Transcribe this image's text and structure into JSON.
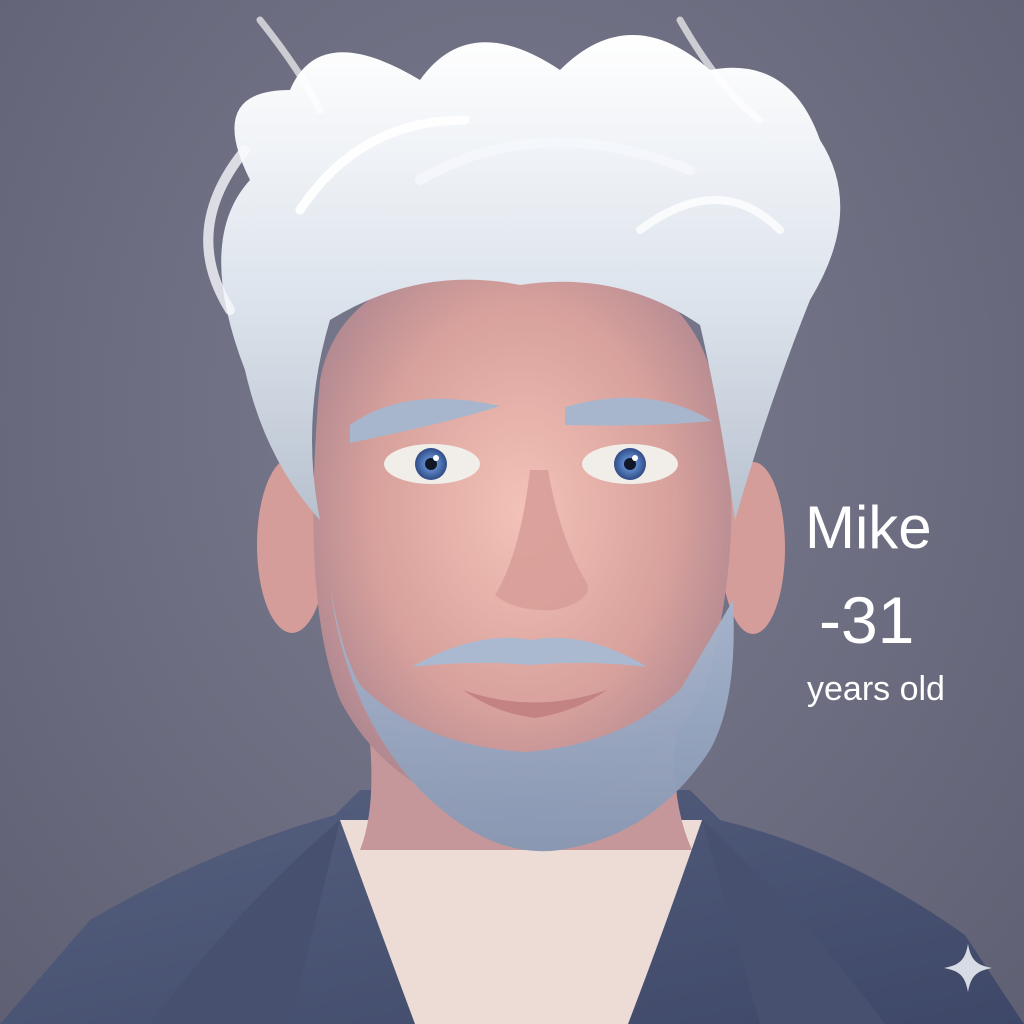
{
  "caption": {
    "name": "Mike",
    "age": "-31",
    "unit": "years old"
  },
  "colors": {
    "background": "#6e6f81",
    "hair": "#e7ebf2",
    "eyes": "#5d86c8",
    "jacket": "#495478",
    "text": "#ffffff"
  },
  "icons": {
    "corner_mark": "sparkle-icon"
  }
}
